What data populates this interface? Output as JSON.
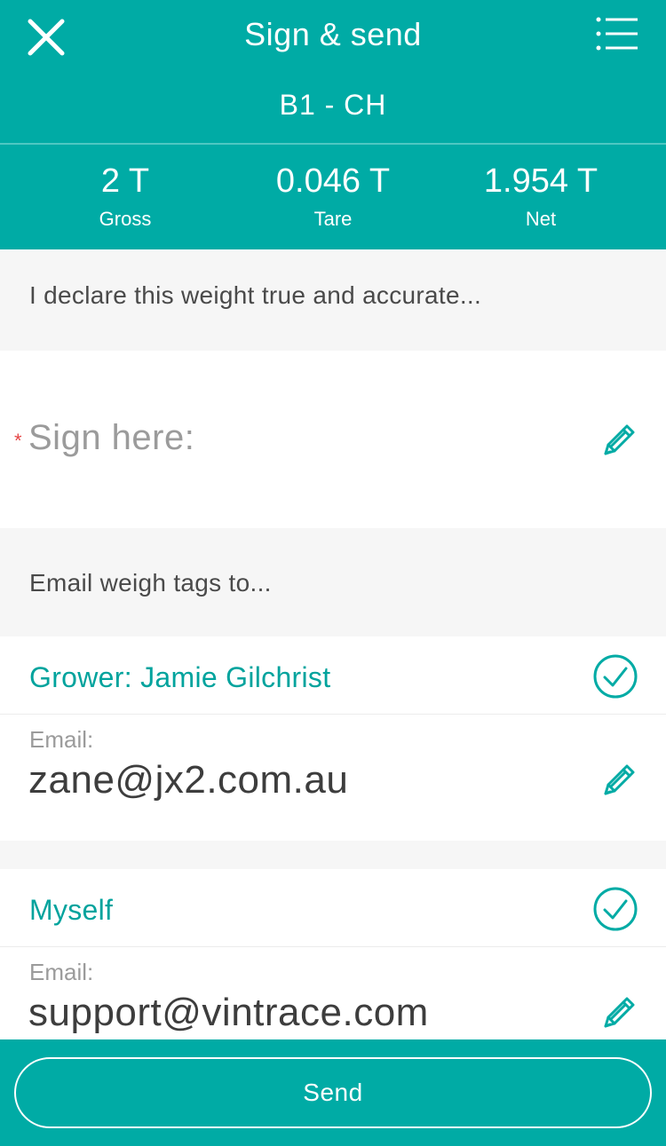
{
  "header": {
    "title": "Sign & send",
    "subtitle": "B1 - CH",
    "close_icon": "close-icon",
    "menu_icon": "menu-list-icon",
    "background_color": "#00aba5"
  },
  "stats": [
    {
      "value": "2 T",
      "label": "Gross"
    },
    {
      "value": "0.046 T",
      "label": "Tare"
    },
    {
      "value": "1.954 T",
      "label": "Net"
    }
  ],
  "declaration": {
    "text": "I declare this weight true and accurate..."
  },
  "signature": {
    "required_marker": "*",
    "label": "Sign here:",
    "edit_icon": "pencil-icon"
  },
  "email_section": {
    "heading": "Email weigh tags to...",
    "recipients": [
      {
        "label": "Grower: Jamie Gilchrist",
        "checked": true,
        "email_label": "Email:",
        "email": "zane@jx2.com.au"
      },
      {
        "label": "Myself",
        "checked": true,
        "email_label": "Email:",
        "email": "support@vintrace.com"
      }
    ]
  },
  "footer": {
    "send_label": "Send"
  },
  "colors": {
    "accent": "#00aba5",
    "accent_text": "#00a39d",
    "required": "#e54545"
  }
}
